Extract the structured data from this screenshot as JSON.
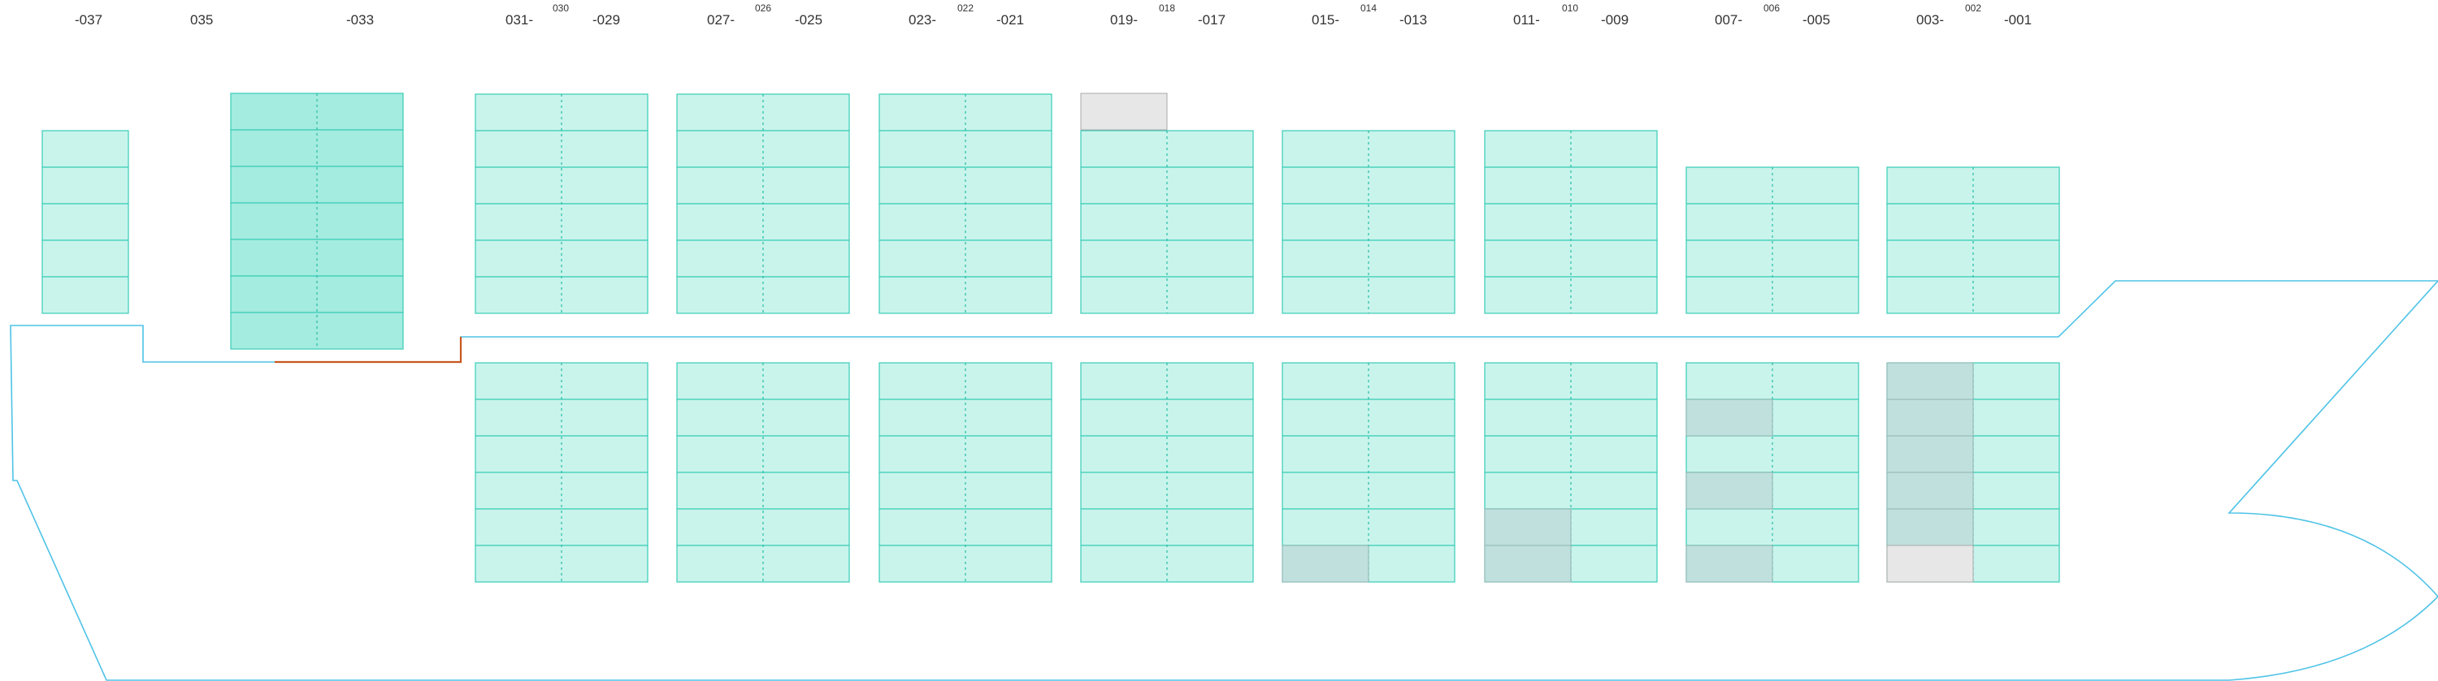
{
  "colors": {
    "cell_fill": "#c9f4ec",
    "cell_fill_highlight": "#a4ebe0",
    "cell_stroke": "#37cdb6",
    "cell_divider": "#2fbfa8",
    "grey_cell": "#bfe0dd",
    "light_grey_cell": "#e7e7e7",
    "hull": "#4ec3e6",
    "orange_line": "#c8561f",
    "label_text": "#333333"
  },
  "bay_labels": [
    {
      "text": "-037"
    },
    {
      "text": "035"
    },
    {
      "text": "-033"
    },
    {
      "text": "031-"
    },
    {
      "text": "030"
    },
    {
      "text": "-029"
    },
    {
      "text": "027-"
    },
    {
      "text": "026"
    },
    {
      "text": "-025"
    },
    {
      "text": "023-"
    },
    {
      "text": "022"
    },
    {
      "text": "-021"
    },
    {
      "text": "019-"
    },
    {
      "text": "018"
    },
    {
      "text": "-017"
    },
    {
      "text": "015-"
    },
    {
      "text": "014"
    },
    {
      "text": "-013"
    },
    {
      "text": "011-"
    },
    {
      "text": "010"
    },
    {
      "text": "-009"
    },
    {
      "text": "007-"
    },
    {
      "text": "006"
    },
    {
      "text": "-005"
    },
    {
      "text": "003-"
    },
    {
      "text": "002"
    },
    {
      "text": "-001"
    }
  ]
}
